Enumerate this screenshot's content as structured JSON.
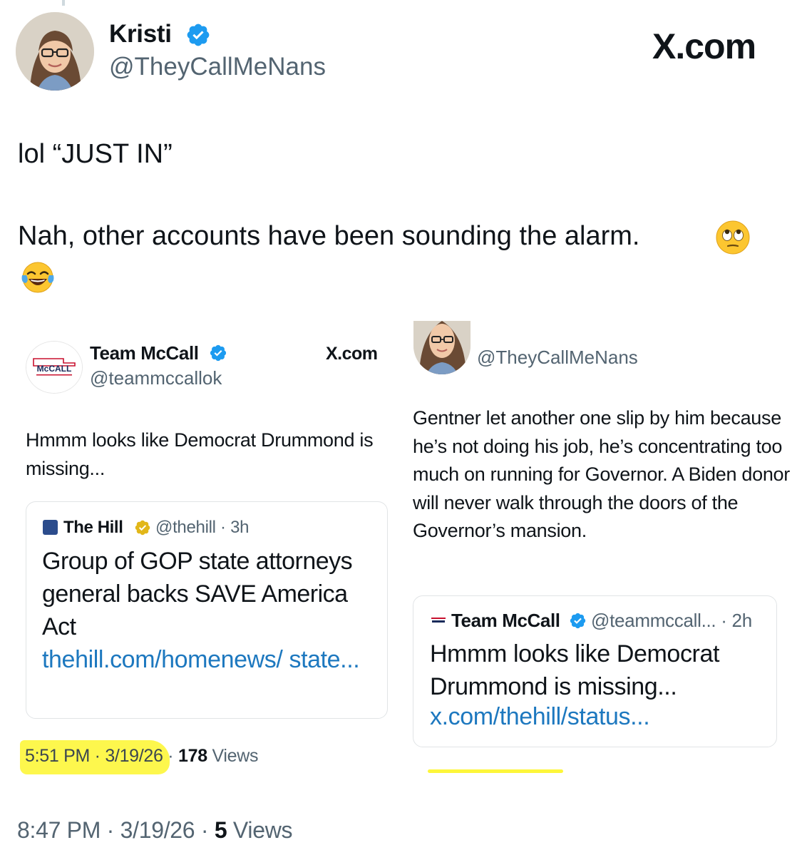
{
  "header": {
    "display_name": "Kristi",
    "handle": "@TheyCallMeNans",
    "brand": "X.com"
  },
  "tweet": {
    "line1": "lol “JUST IN”",
    "line2": "Nah, other accounts have been sounding the alarm.",
    "emoji1": "face-with-rolling-eyes",
    "emoji2": "face-with-tears-of-joy"
  },
  "left_shot": {
    "display_name": "Team McCall",
    "handle": "@teammccallok",
    "brand": "X.com",
    "logo_text": "McCALL",
    "text": "Hmmm looks like Democrat Drummond is missing...",
    "quote": {
      "source": "The Hill",
      "meta": "@thehill · 3h",
      "headline": "Group of GOP state attorneys general backs SAVE America Act",
      "link": "thehill.com/homenews/ state..."
    },
    "timestamp": "5:51 PM · 3/19/26",
    "dot": "·",
    "views_count": "178",
    "views_label": "Views"
  },
  "right_shot": {
    "handle": "@TheyCallMeNans",
    "text": "Gentner let another one slip by him because he’s not doing his job, he’s concentrating too much on running for Governor. A Biden donor will never walk through the doors of the Governor’s mansion.",
    "quote": {
      "name": "Team McCall",
      "meta": "@teammccall... · 2h",
      "text": "Hmmm looks like Democrat Drummond is missing...",
      "link": "x.com/thehill/status..."
    }
  },
  "footer": {
    "timestamp": "8:47 PM · 3/19/26 ·",
    "views_count": "5",
    "views_label": "Views"
  },
  "colors": {
    "verified_blue": "#1d9bf0",
    "gold_badge": "#e2b719",
    "link_blue": "#1d78bf",
    "highlight_yellow": "#fdf63a",
    "secondary_text": "#536471"
  }
}
